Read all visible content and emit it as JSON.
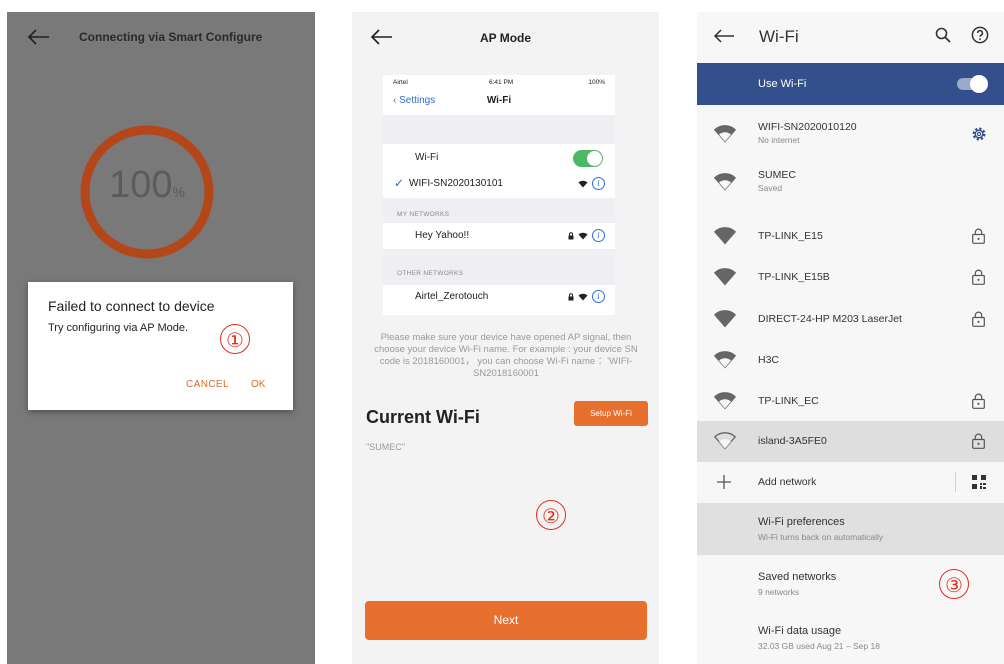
{
  "panel1": {
    "title": "Connecting via Smart Configure",
    "progress_value": "100",
    "progress_unit": "%",
    "progress_fraction": 1.0,
    "dialog": {
      "title": "Failed to connect to device",
      "message": "Try configuring via AP Mode.",
      "cancel_label": "CANCEL",
      "ok_label": "OK"
    },
    "step_marker": "①"
  },
  "panel2": {
    "title": "AP Mode",
    "ios": {
      "carrier": "Airtel",
      "time": "6:41 PM",
      "battery": "100%",
      "back_label": "Settings",
      "page_title": "Wi-Fi",
      "wifi_label": "Wi-Fi",
      "connected_network": "WIFI-SN2020130101",
      "my_networks_header": "MY NETWORKS",
      "my_networks": [
        "Hey Yahoo!!"
      ],
      "other_networks_header": "OTHER NETWORKS",
      "other_networks": [
        "Airtel_Zerotouch"
      ]
    },
    "note": "Please make sure your device have opened AP signal, then choose your device Wi-Fi name. For example : your device SN code is 2018160001， you can choose Wi-Fi name ：'WIFI-SN2018160001",
    "current_wifi_label": "Current Wi-Fi",
    "setup_button": "Setup Wi-Fi",
    "current_ssid": "\"SUMEC\"",
    "next_button": "Next",
    "step_marker": "②"
  },
  "panel3": {
    "title": "Wi-Fi",
    "use_wifi_label": "Use Wi-Fi",
    "use_wifi_on": true,
    "networks": [
      {
        "name": "WIFI-SN2020010120",
        "sub": "No internet",
        "trailing": "gear-icon"
      },
      {
        "name": "SUMEC",
        "sub": "Saved",
        "trailing": ""
      },
      {
        "name": "TP-LINK_E15",
        "sub": "",
        "trailing": "lock-icon"
      },
      {
        "name": "TP-LINK_E15B",
        "sub": "",
        "trailing": "lock-icon"
      },
      {
        "name": "DIRECT-24-HP M203 LaserJet",
        "sub": "",
        "trailing": "lock-icon"
      },
      {
        "name": "H3C",
        "sub": "",
        "trailing": ""
      },
      {
        "name": "TP-LINK_EC",
        "sub": "",
        "trailing": "lock-icon"
      },
      {
        "name": "island-3A5FE0",
        "sub": "",
        "trailing": "lock-icon"
      }
    ],
    "add_network_label": "Add network",
    "preferences": [
      {
        "name": "Wi-Fi preferences",
        "sub": "Wi-Fi turns back on automatically"
      },
      {
        "name": "Saved networks",
        "sub": "9 networks"
      },
      {
        "name": "Wi-Fi data usage",
        "sub": "32.03 GB used Aug 21 – Sep 18"
      }
    ],
    "step_marker": "③"
  },
  "colors": {
    "accent_orange": "#e8702f",
    "ring": "#b4471a",
    "header_blue": "#34508c",
    "marker_red": "#e03020"
  }
}
